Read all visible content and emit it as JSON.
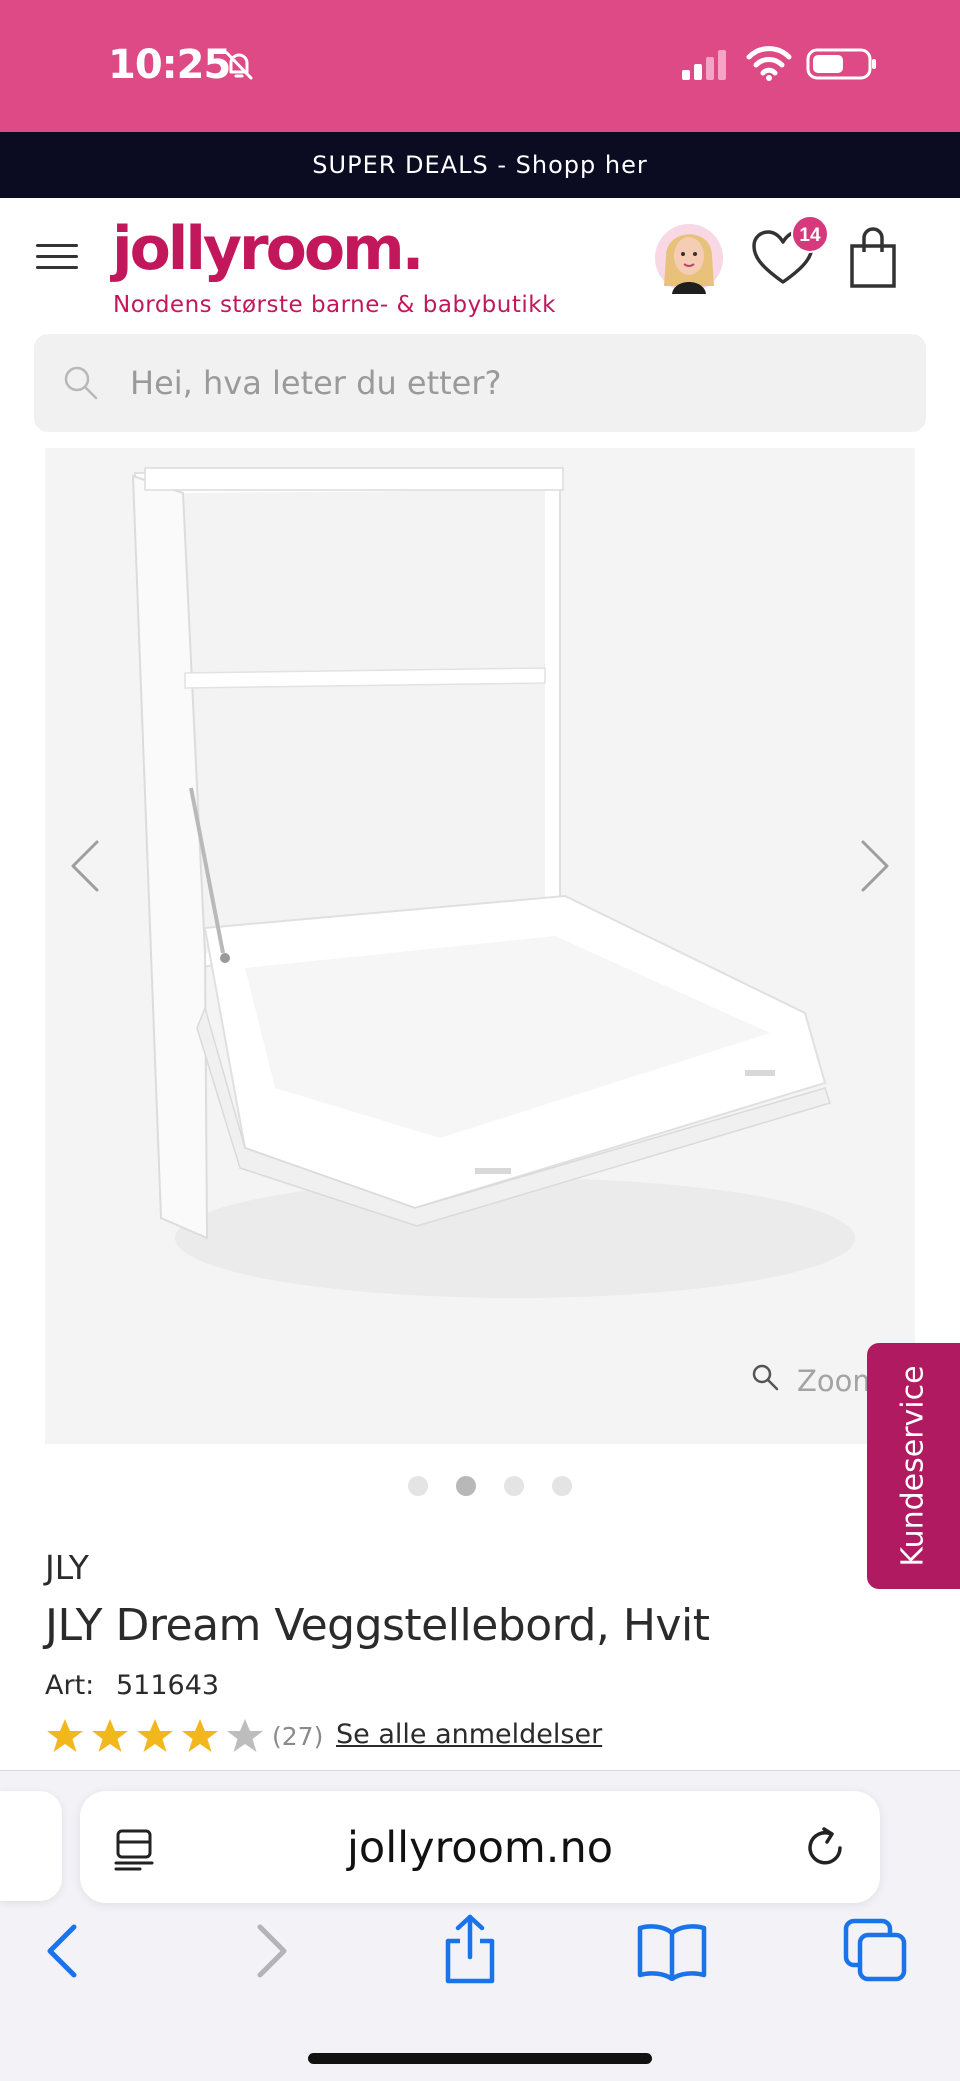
{
  "status_bar": {
    "time": "10:25",
    "icons": [
      "bell-slash-icon",
      "cellular-signal-icon",
      "wifi-icon",
      "battery-icon"
    ],
    "background_color": "#de4a86"
  },
  "promo_bar": {
    "text": "SUPER DEALS - Shopp her",
    "background_color": "#0b0b22"
  },
  "header": {
    "logo": "jollyroom.",
    "tagline": "Nordens største barne- & babybutikk",
    "wishlist_count": "14",
    "brand_color": "#c2185b"
  },
  "search": {
    "placeholder": "Hei, hva leter du etter?"
  },
  "gallery": {
    "zoom_label": "Zoom",
    "slide_count": 4,
    "active_slide": 2
  },
  "customer_service": {
    "label": "Kundeservice",
    "color": "#b01a60"
  },
  "product": {
    "brand": "JLY",
    "title": "JLY Dream Veggstellebord, Hvit",
    "art_label": "Art:",
    "art_number": "511643",
    "rating": 4,
    "rating_max": 5,
    "review_count": "(27)",
    "reviews_link": "Se alle anmeldelser"
  },
  "browser": {
    "url": "jollyroom.no",
    "toolbar": [
      "back-icon",
      "forward-icon",
      "share-icon",
      "bookmarks-icon",
      "tabs-icon"
    ],
    "accent_color": "#1a73e8"
  }
}
